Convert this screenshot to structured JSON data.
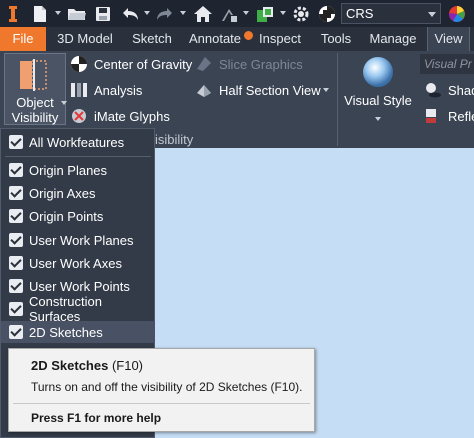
{
  "quick_access": {
    "icons": [
      "inventor-logo-icon",
      "new-file-icon",
      "open-folder-icon",
      "save-icon",
      "undo-icon",
      "redo-icon",
      "home-icon",
      "return-icon",
      "update-icon",
      "appearance-ball-icon"
    ],
    "coordinate_system": "CRS"
  },
  "tabs": {
    "file": "File",
    "model_3d": "3D Model",
    "sketch": "Sketch",
    "annotate": "Annotate",
    "inspect": "Inspect",
    "tools": "Tools",
    "manage": "Manage",
    "view": "View"
  },
  "ribbon": {
    "object_visibility_line1": "Object",
    "object_visibility_line2": "Visibility",
    "center_of_gravity": "Center of Gravity",
    "slice_graphics": "Slice Graphics",
    "analysis": "Analysis",
    "half_section_view": "Half Section View",
    "imate_glyphs": "iMate Glyphs",
    "visibility_panel_suffix": "isibility",
    "visual_style": "Visual Style",
    "visual_preset_placeholder": "Visual Pr",
    "shadows": "Shad",
    "reflections": "Refle"
  },
  "menu": {
    "items": [
      "All Workfeatures",
      "Origin Planes",
      "Origin Axes",
      "Origin Points",
      "User Work Planes",
      "User Work Axes",
      "User Work Points",
      "Construction Surfaces",
      "2D Sketches"
    ]
  },
  "tooltip": {
    "title": "2D Sketches",
    "shortcut": "(F10)",
    "description": "Turns on and off the visibility of 2D Sketches (F10).",
    "help": "Press F1 for more help"
  },
  "colors": {
    "file_tab": "#f0782c",
    "ribbon_bg": "#3b4453",
    "canvas_bg": "#c5ddf5",
    "menu_bg": "#333b48"
  }
}
